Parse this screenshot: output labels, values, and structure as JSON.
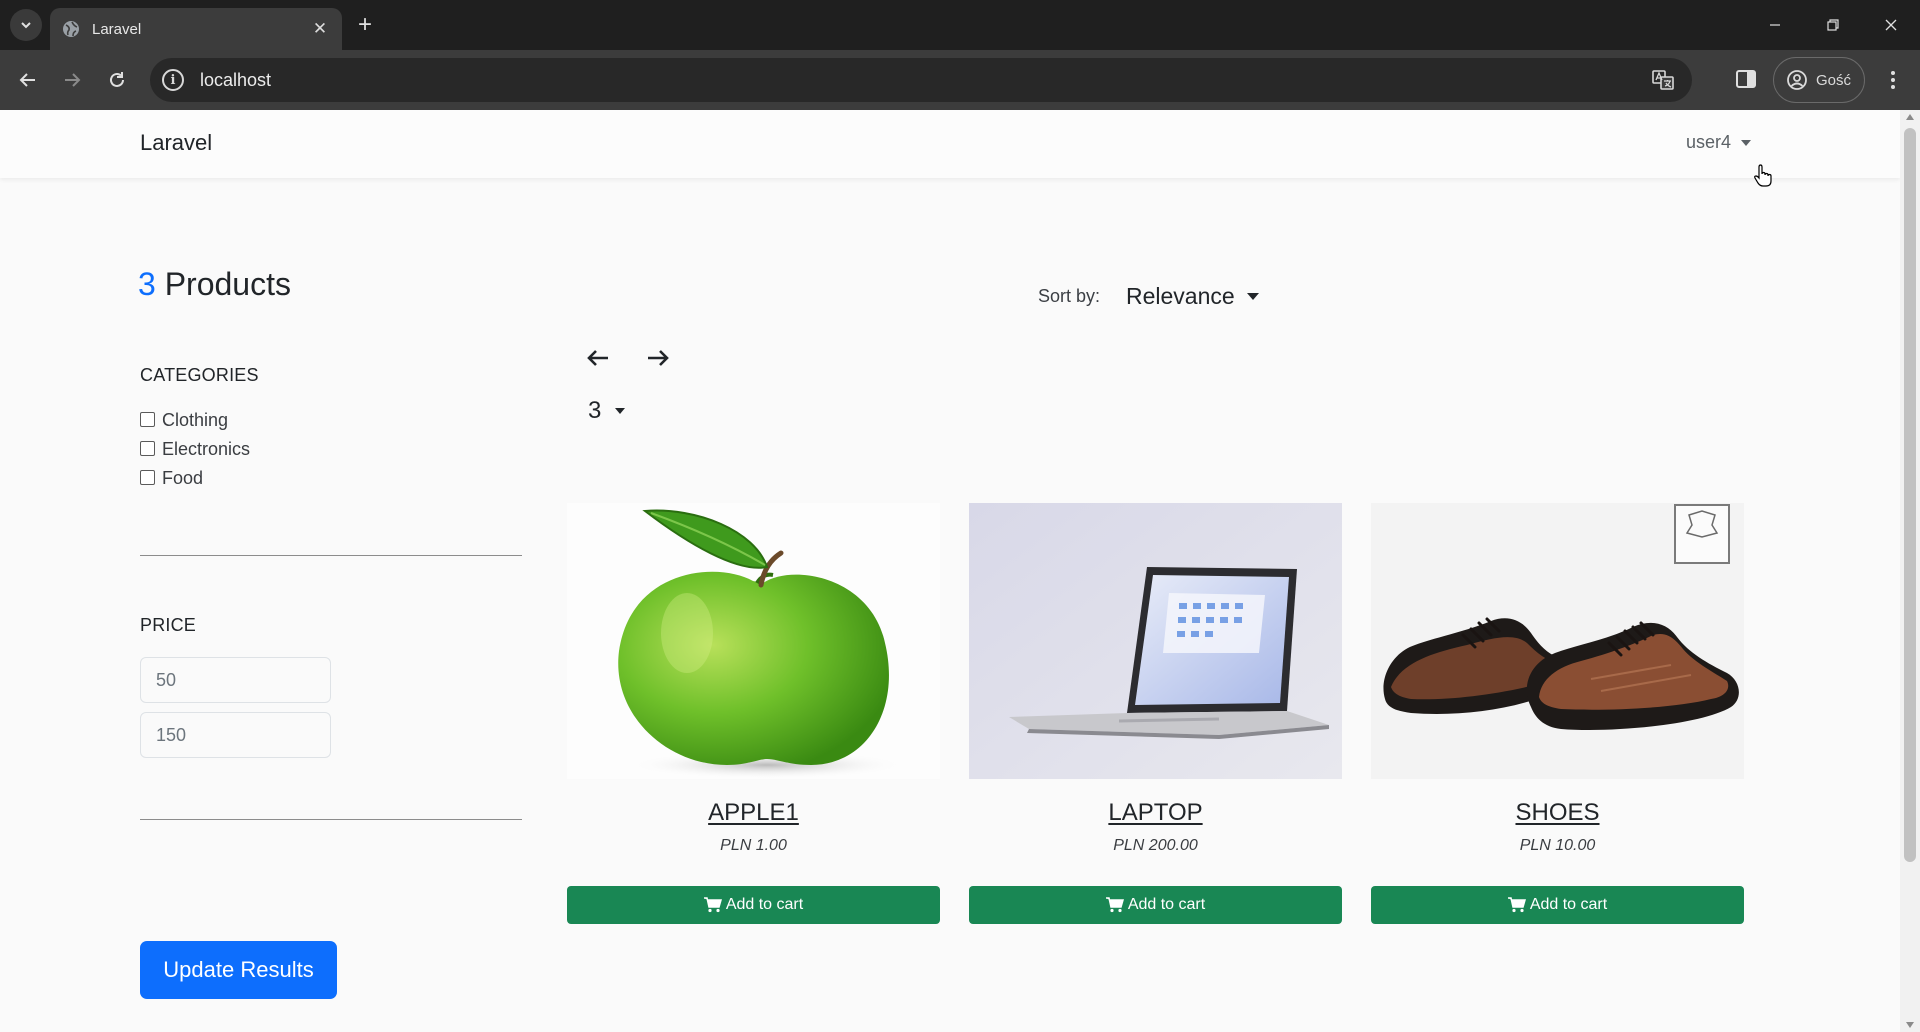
{
  "browser": {
    "tab_title": "Laravel",
    "url": "localhost",
    "profile_label": "Gość"
  },
  "navbar": {
    "brand": "Laravel",
    "user": "user4"
  },
  "listing": {
    "count": "3",
    "count_label": "Products",
    "sort_label": "Sort by:",
    "sort_value": "Relevance",
    "per_page": "3"
  },
  "sidebar": {
    "categories_title": "CATEGORIES",
    "categories": [
      {
        "label": "Clothing",
        "checked": false
      },
      {
        "label": "Electronics",
        "checked": false
      },
      {
        "label": "Food",
        "checked": false
      }
    ],
    "price_title": "PRICE",
    "price_min": "50",
    "price_max": "150",
    "update_label": "Update Results"
  },
  "products": [
    {
      "name": "APPLE1",
      "price": "PLN 1.00",
      "image": "green-apple",
      "button": "Add to cart"
    },
    {
      "name": "LAPTOP",
      "price": "PLN 200.00",
      "image": "laptop",
      "button": "Add to cart"
    },
    {
      "name": "SHOES",
      "price": "PLN 10.00",
      "image": "brown-shoes",
      "button": "Add to cart"
    }
  ],
  "colors": {
    "primary": "#0d6efd",
    "success": "#198754",
    "chrome_dark": "#1f1f1f",
    "chrome_toolbar": "#3c3c3c"
  }
}
